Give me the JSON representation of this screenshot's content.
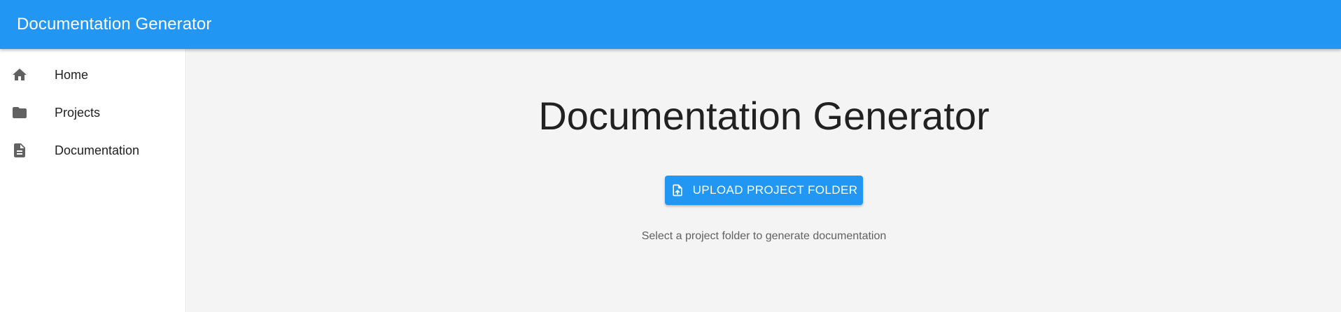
{
  "header": {
    "title": "Documentation Generator"
  },
  "sidebar": {
    "items": [
      {
        "label": "Home",
        "icon": "home-icon"
      },
      {
        "label": "Projects",
        "icon": "folder-icon"
      },
      {
        "label": "Documentation",
        "icon": "document-icon"
      }
    ]
  },
  "main": {
    "title": "Documentation Generator",
    "upload_button_label": "UPLOAD PROJECT FOLDER",
    "upload_button_icon": "file-upload-icon",
    "helper_text": "Select a project folder to generate documentation"
  },
  "colors": {
    "primary": "#2196f3",
    "background": "#f4f4f4"
  }
}
